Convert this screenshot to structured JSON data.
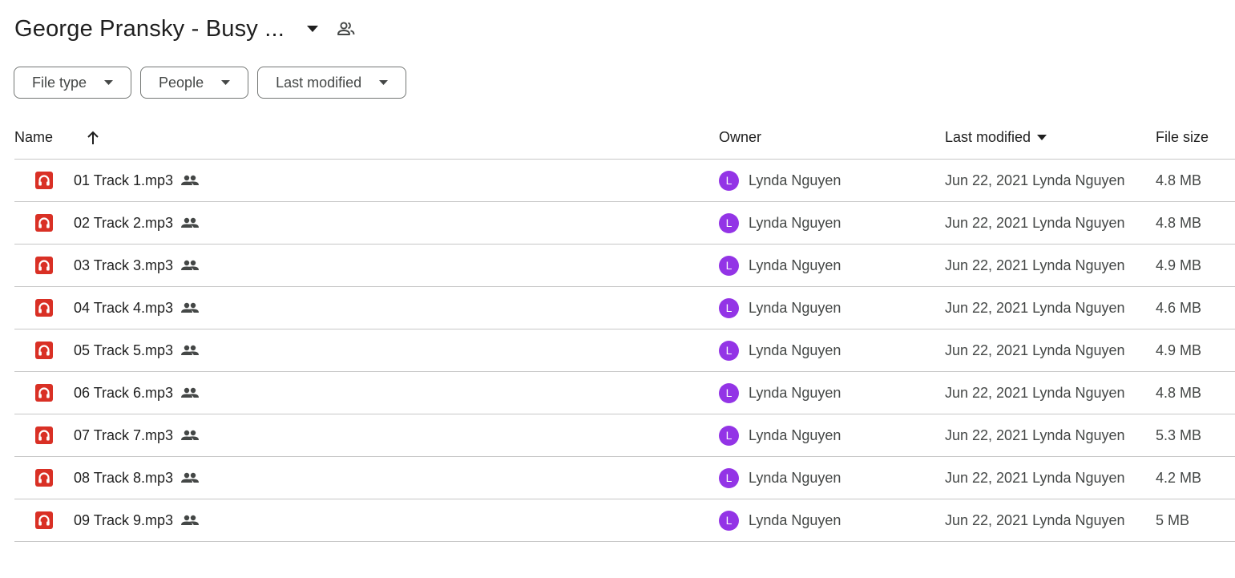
{
  "header": {
    "title": "George Pransky - Busy ...",
    "caret_icon": "caret-down-icon",
    "shared_icon": "shared-people-icon"
  },
  "filters": [
    {
      "label": "File type"
    },
    {
      "label": "People"
    },
    {
      "label": "Last modified"
    }
  ],
  "columns": {
    "name": "Name",
    "owner": "Owner",
    "modified": "Last modified",
    "size": "File size"
  },
  "colors": {
    "audio_icon": "#d93025",
    "avatar": "#9334e6",
    "divider": "#c7c7c7"
  },
  "files": [
    {
      "name": "01 Track 1.mp3",
      "owner_initial": "L",
      "owner": "Lynda Nguyen",
      "modified": "Jun 22, 2021 Lynda Nguyen",
      "size": "4.8 MB"
    },
    {
      "name": "02 Track 2.mp3",
      "owner_initial": "L",
      "owner": "Lynda Nguyen",
      "modified": "Jun 22, 2021 Lynda Nguyen",
      "size": "4.8 MB"
    },
    {
      "name": "03 Track 3.mp3",
      "owner_initial": "L",
      "owner": "Lynda Nguyen",
      "modified": "Jun 22, 2021 Lynda Nguyen",
      "size": "4.9 MB"
    },
    {
      "name": "04 Track 4.mp3",
      "owner_initial": "L",
      "owner": "Lynda Nguyen",
      "modified": "Jun 22, 2021 Lynda Nguyen",
      "size": "4.6 MB"
    },
    {
      "name": "05 Track 5.mp3",
      "owner_initial": "L",
      "owner": "Lynda Nguyen",
      "modified": "Jun 22, 2021 Lynda Nguyen",
      "size": "4.9 MB"
    },
    {
      "name": "06 Track 6.mp3",
      "owner_initial": "L",
      "owner": "Lynda Nguyen",
      "modified": "Jun 22, 2021 Lynda Nguyen",
      "size": "4.8 MB"
    },
    {
      "name": "07 Track 7.mp3",
      "owner_initial": "L",
      "owner": "Lynda Nguyen",
      "modified": "Jun 22, 2021 Lynda Nguyen",
      "size": "5.3 MB"
    },
    {
      "name": "08 Track 8.mp3",
      "owner_initial": "L",
      "owner": "Lynda Nguyen",
      "modified": "Jun 22, 2021 Lynda Nguyen",
      "size": "4.2 MB"
    },
    {
      "name": "09 Track 9.mp3",
      "owner_initial": "L",
      "owner": "Lynda Nguyen",
      "modified": "Jun 22, 2021 Lynda Nguyen",
      "size": "5 MB"
    }
  ]
}
